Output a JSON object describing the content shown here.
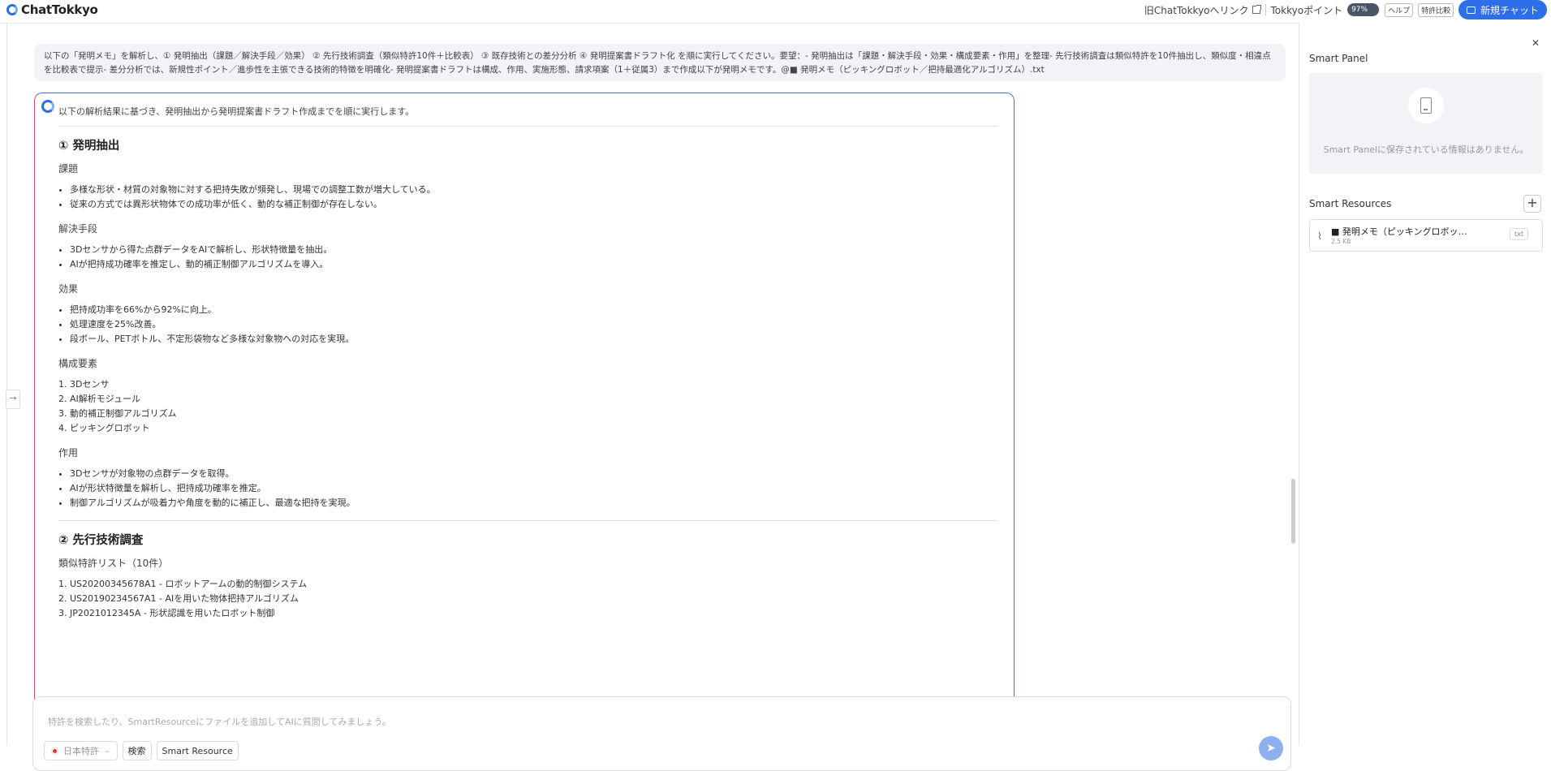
{
  "app": {
    "name": "ChatTokkyo"
  },
  "header": {
    "old_link_label": "旧ChatTokkyoへリンク",
    "points_label": "Tokkyoポイント",
    "points_value": "97%",
    "points_fraction": 0.97,
    "help_label": "ヘルプ",
    "compare_label": "特許比較",
    "new_chat_label": "新規チャット"
  },
  "user_message": "以下の「発明メモ」を解析し、① 発明抽出（課題／解決手段／効果） ② 先行技術調査（類似特許10件＋比較表） ③ 既存技術との差分分析 ④ 発明提案書ドラフト化 を順に実行してください。要望：- 発明抽出は「課題・解決手段・効果・構成要素・作用」を整理- 先行技術調査は類似特許を10件抽出し、類似度・相違点を比較表で提示- 差分分析では、新規性ポイント／進歩性を主張できる技術的特徴を明確化- 発明提案書ドラフトは構成、作用、実施形態、請求項案（1＋従属3）まで作成以下が発明メモです。@■ 発明メモ（ピッキングロボット／把持最適化アルゴリズム）.txt",
  "response": {
    "intro": "以下の解析結果に基づき、発明抽出から発明提案書ドラフト作成までを順に実行します。",
    "section1": {
      "title": "① 発明抽出",
      "problem_title": "課題",
      "problem": [
        "多様な形状・材質の対象物に対する把持失敗が頻発し、現場での調整工数が増大している。",
        "従来の方式では異形状物体での成功率が低く、動的な補正制御が存在しない。"
      ],
      "solution_title": "解決手段",
      "solution": [
        "3Dセンサから得た点群データをAIで解析し、形状特徴量を抽出。",
        "AIが把持成功確率を推定し、動的補正制御アルゴリズムを導入。"
      ],
      "effect_title": "効果",
      "effect": [
        "把持成功率を66%から92%に向上。",
        "処理速度を25%改善。",
        "段ボール、PETボトル、不定形袋物など多様な対象物への対応を実現。"
      ],
      "components_title": "構成要素",
      "components": [
        "1. 3Dセンサ",
        "2. AI解析モジュール",
        "3. 動的補正制御アルゴリズム",
        "4. ピッキングロボット"
      ],
      "action_title": "作用",
      "action": [
        "3Dセンサが対象物の点群データを取得。",
        "AIが形状特徴量を解析し、把持成功確率を推定。",
        "制御アルゴリズムが吸着力や角度を動的に補正し、最適な把持を実現。"
      ]
    },
    "section2": {
      "title": "② 先行技術調査",
      "list_title": "類似特許リスト（10件）",
      "patents": [
        "1. US20200345678A1 - ロボットアームの動的制御システム",
        "2. US20190234567A1 - AIを用いた物体把持アルゴリズム",
        "3. JP2021012345A - 形状認識を用いたロボット制御"
      ]
    }
  },
  "input": {
    "placeholder": "特許を検索したり、SmartResourceにファイルを追加してAIに質問してみましょう。",
    "country_select": "日本特許",
    "search_button": "検索",
    "smart_resource_button": "Smart Resource"
  },
  "right_panel": {
    "smart_panel_title": "Smart Panel",
    "smart_panel_empty": "Smart Panelに保存されている情報はありません。",
    "smart_resources_title": "Smart Resources",
    "resource": {
      "name": "■ 発明メモ（ピッキングロボット／把持最適化アルゴリズム）.txt",
      "size": "2.5 KB",
      "type": "txt"
    }
  },
  "colors": {
    "accent": "#2d6fe8",
    "card_border_start": "#d44a7e",
    "card_border_end": "#4a6fe0"
  }
}
